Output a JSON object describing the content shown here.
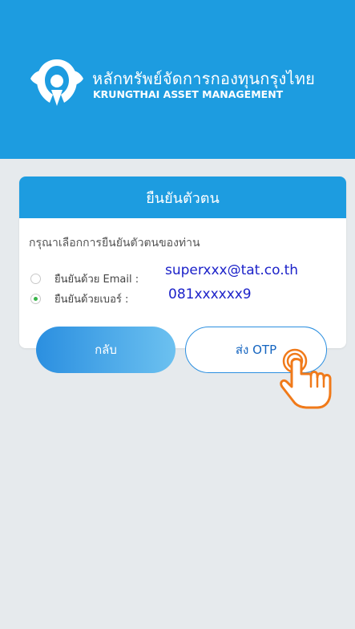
{
  "header": {
    "brand_th": "หลักทรัพย์จัดการกองทุนกรุงไทย",
    "brand_en": "KRUNGTHAI ASSET MANAGEMENT"
  },
  "card": {
    "title": "ยืนยันตัวตน",
    "prompt": "กรุณาเลือกการยืนยันตัวตนของท่าน",
    "options": [
      {
        "label": "ยืนยันด้วย Email :",
        "value": "superxxx@tat.co.th",
        "selected": false
      },
      {
        "label": "ยืนยันด้วยเบอร์ :",
        "value": "081xxxxxx9",
        "selected": true
      }
    ]
  },
  "buttons": {
    "back": "กลับ",
    "send_otp": "ส่ง OTP"
  },
  "colors": {
    "primary": "#1d9ce0",
    "value_text": "#1c22c9",
    "accent_orange": "#f07a1a",
    "radio_selected": "#39b54a"
  }
}
